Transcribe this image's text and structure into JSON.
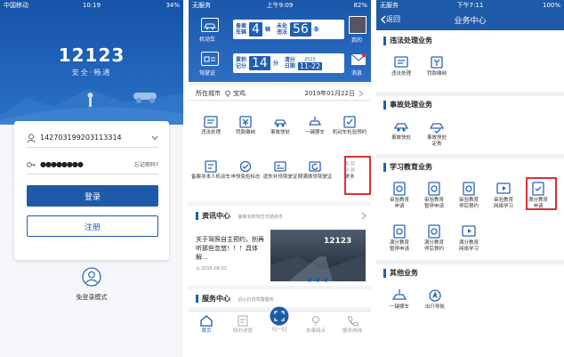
{
  "p1": {
    "status": {
      "carrier": "中国移动",
      "time": "10:19",
      "battery": "34%"
    },
    "logo": "12123",
    "slogan": "安全·畅通",
    "account_value": "142703199203113314",
    "password_value": "●●●●●●●●",
    "forgot_label": "忘记密码?",
    "login_label": "登录",
    "register_label": "注册",
    "guest_label": "免登录模式"
  },
  "p2": {
    "status": {
      "carrier": "无服务",
      "time": "上午9:09",
      "battery": "82%"
    },
    "vehicle_label": "机动车",
    "license_label": "驾驶证",
    "vehicles_text": "备案\n车辆",
    "vehicles_count": "4",
    "vehicles_unit": "辆",
    "unhandled_text": "未处\n违法",
    "unhandled_count": "56",
    "unhandled_unit": "条",
    "points_text": "累积\n记分",
    "points_count": "14",
    "points_unit": "分",
    "clear_text": "清分\n日期",
    "clear_year": "2015",
    "clear_date": "11-22",
    "mine_label": "我的",
    "msg_label": "消息",
    "city_label": "所在城市",
    "city_value": "宝鸡",
    "date_value": "2019年01月22日",
    "services": [
      {
        "name": "违法处理",
        "icon": "violation-icon"
      },
      {
        "name": "罚款缴纳",
        "icon": "fine-icon"
      },
      {
        "name": "事故快处",
        "icon": "accident-icon"
      },
      {
        "name": "一键挪车",
        "icon": "move-car-icon"
      },
      {
        "name": "机动车检验预约",
        "icon": "inspection-icon"
      },
      {
        "name": "备案非本人机动车",
        "icon": "register-car-icon"
      },
      {
        "name": "申领免检标志",
        "icon": "exempt-icon"
      },
      {
        "name": "遗失补领驾驶证",
        "icon": "reissue-icon"
      },
      {
        "name": "期满换领驾驶证",
        "icon": "renew-icon"
      },
      {
        "name": "更多",
        "icon": "more-icon"
      }
    ],
    "news_title": "资讯中心",
    "news_sub": "最新实时地方交通资讯",
    "news_headline": "关于驾照自主预约，别再听那些忽悠！！！具体解...",
    "news_date": "2016-06-02",
    "news_img_text": "12123",
    "service_center": "服务中心",
    "service_sub": "近心打造驾警服务",
    "tabs": [
      {
        "name": "首页",
        "icon": "home-icon"
      },
      {
        "name": "网办进度",
        "icon": "progress-icon"
      },
      {
        "name": "扫一扫",
        "icon": "scan-icon"
      },
      {
        "name": "办事网点",
        "icon": "location-icon"
      },
      {
        "name": "服务热线",
        "icon": "hotline-icon"
      }
    ]
  },
  "p3": {
    "status": {
      "carrier": "无服务",
      "time": "下午7:11",
      "battery": "100%"
    },
    "back_label": "返回",
    "title": "业务中心",
    "sections": [
      {
        "title": "违法处理业务",
        "items": [
          "违法处理",
          "罚款缴纳"
        ]
      },
      {
        "title": "事故处理业务",
        "items": [
          "事故快处",
          "事故快处\n定责"
        ]
      },
      {
        "title": "学习教育业务",
        "items": [
          "审验教育\n申请",
          "审验教育\n暂停申请",
          "审验教育\n停后预约",
          "审验教育\n网络学习",
          "满分教育\n申请",
          "满分教育\n暂停申请",
          "满分教育\n停后预约",
          "满分教育\n网络学习"
        ]
      },
      {
        "title": "其他业务",
        "items": [
          "一键挪车",
          "出行导航"
        ]
      }
    ]
  },
  "colors": {
    "primary": "#1f5aa8",
    "highlight": "#e03030"
  }
}
